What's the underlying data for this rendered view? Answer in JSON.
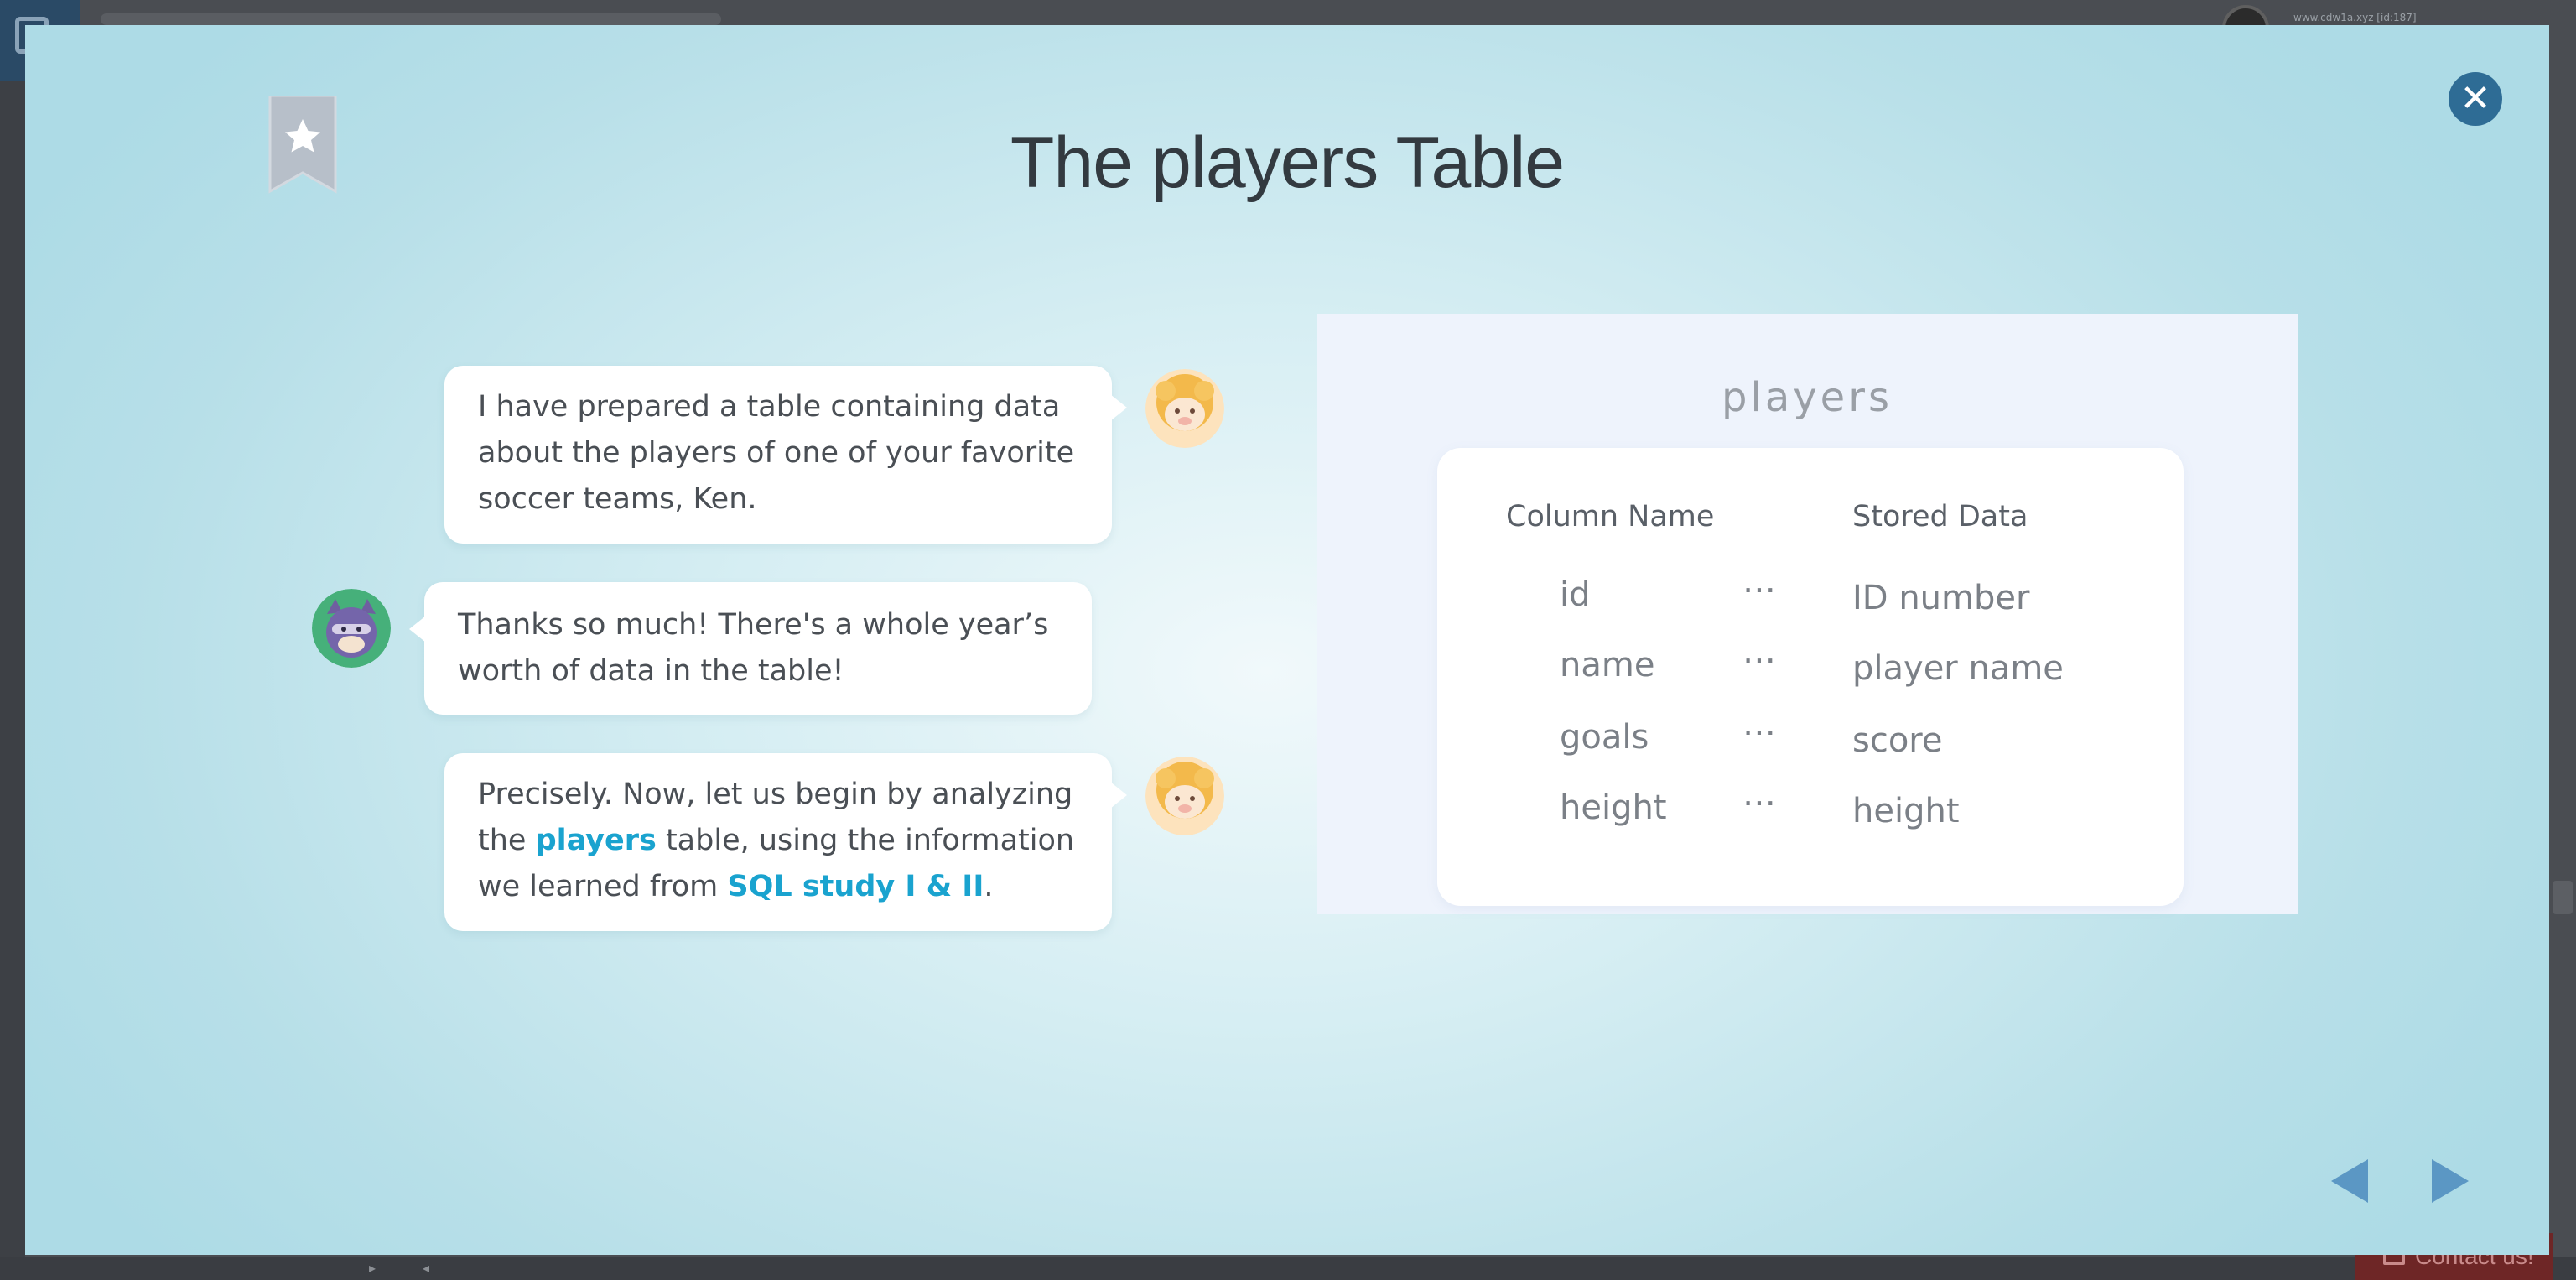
{
  "background": {
    "user_label": "www.cdw1a.xyz [id:187]",
    "contact_label": "Contact us!"
  },
  "modal": {
    "title": "The players Table"
  },
  "chat": [
    {
      "speaker": "sheep",
      "text": "I have prepared a table containing data about the players of one of your favorite soccer teams, Ken."
    },
    {
      "speaker": "ken",
      "text": "Thanks so much! There's a whole year’s worth of data in the table!"
    },
    {
      "speaker": "sheep",
      "text_before": "Precisely. Now, let us begin by analyzing the ",
      "highlight_table": "players",
      "text_middle": " table, using the information we learned from ",
      "highlight_link": "SQL study I & II",
      "text_after": "."
    }
  ],
  "table_panel": {
    "title": "players",
    "header_column": "Column Name",
    "header_data": "Stored Data",
    "separator": "⋯",
    "rows": [
      {
        "column": "id",
        "data": "ID number"
      },
      {
        "column": "name",
        "data": "player name"
      },
      {
        "column": "goals",
        "data": "score"
      },
      {
        "column": "height",
        "data": "height"
      }
    ]
  },
  "icons": {
    "bookmark": "bookmark-star-icon",
    "close": "close-icon",
    "prev": "prev-arrow-icon",
    "next": "next-arrow-icon"
  },
  "colors": {
    "accent_link": "#1aa3cf",
    "close_button": "#2e6c95",
    "nav_arrows": "#5b97c4"
  }
}
